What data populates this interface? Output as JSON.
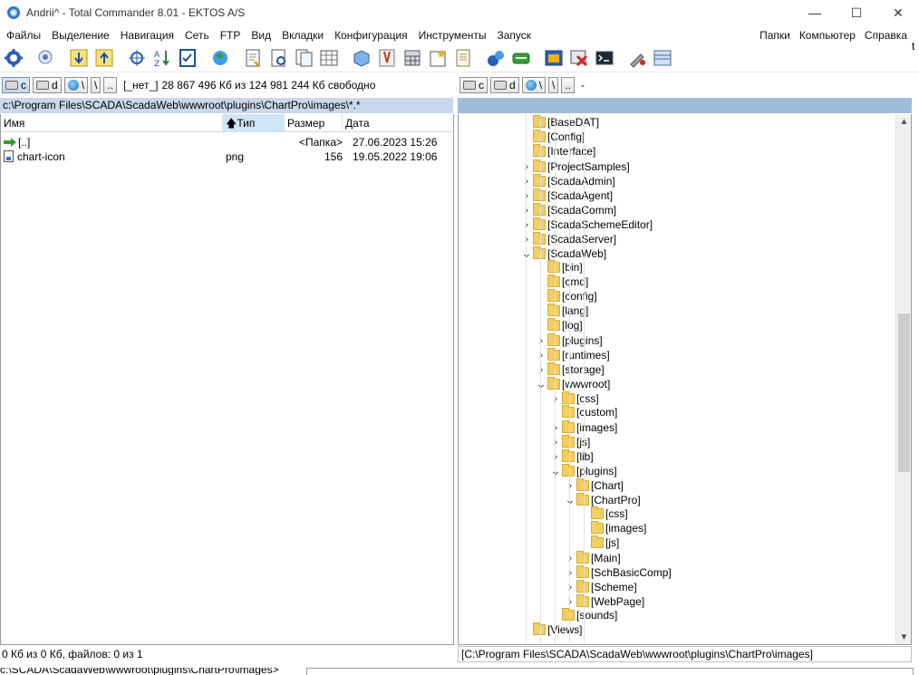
{
  "window": {
    "title": "Andrii^ - Total Commander 8.01 - EKTOS A/S",
    "controls": [
      "—",
      "☐",
      "✕"
    ]
  },
  "menu": {
    "left": [
      "Файлы",
      "Выделение",
      "Навигация",
      "Сеть",
      "FTP",
      "Вид",
      "Вкладки",
      "Конфигурация",
      "Инструменты",
      "Запуск"
    ],
    "right": [
      "Папки",
      "Компьютер",
      "Справка"
    ]
  },
  "toolbar": {
    "buttons": [
      "gear-icon",
      "network-settings-icon",
      "sort-down-icon",
      "sort-up-icon",
      "compare-icon",
      "sort-az-icon",
      "checklist-icon",
      "world-icon",
      "view-file-icon",
      "edit-file-icon",
      "copy-file-icon",
      "grid-view-icon",
      "box-icon",
      "rename-tool-icon",
      "calculator-icon",
      "star-icon",
      "notepad-icon",
      "pack-icon",
      "unpack-icon",
      "window-icon",
      "delete-icon",
      "terminal-icon",
      "brush-icon",
      "panel-icon"
    ]
  },
  "left_drivebar": {
    "drives": [
      "c",
      "d"
    ],
    "root": "\\",
    "up": "..",
    "volume": "[_нет_]",
    "free": "28 867 496 Кб из 124 981 244 Кб свободно"
  },
  "right_drivebar": {
    "drives": [
      "c",
      "d"
    ],
    "root": "\\",
    "up": "..",
    "free": "-"
  },
  "left_panel": {
    "path": "c:\\Program Files\\SCADA\\ScadaWeb\\wwwroot\\plugins\\ChartPro\\images\\*.*",
    "columns": [
      "Имя",
      "Тип",
      "Размер",
      "Дата"
    ],
    "sorted_column": "Тип",
    "rows": [
      {
        "name": "[..]",
        "type": "",
        "size": "<Папка>",
        "date": "27.06.2023 15:26"
      },
      {
        "name": "chart-icon",
        "type": "png",
        "size": "156",
        "date": "19.05.2022 19:06"
      }
    ]
  },
  "tree": [
    {
      "label": "[BaseDAT]",
      "level": 0,
      "chev": ""
    },
    {
      "label": "[Config]",
      "level": 0,
      "chev": ""
    },
    {
      "label": "[Interface]",
      "level": 0,
      "chev": ""
    },
    {
      "label": "[ProjectSamples]",
      "level": 0,
      "chev": ">"
    },
    {
      "label": "[ScadaAdmin]",
      "level": 0,
      "chev": ">"
    },
    {
      "label": "[ScadaAgent]",
      "level": 0,
      "chev": ">"
    },
    {
      "label": "[ScadaComm]",
      "level": 0,
      "chev": ">"
    },
    {
      "label": "[ScadaSchemeEditor]",
      "level": 0,
      "chev": ">"
    },
    {
      "label": "[ScadaServer]",
      "level": 0,
      "chev": ">"
    },
    {
      "label": "[ScadaWeb]",
      "level": 0,
      "chev": "v"
    },
    {
      "label": "[bin]",
      "level": 1,
      "chev": ""
    },
    {
      "label": "[cmd]",
      "level": 1,
      "chev": ""
    },
    {
      "label": "[config]",
      "level": 1,
      "chev": ""
    },
    {
      "label": "[lang]",
      "level": 1,
      "chev": ""
    },
    {
      "label": "[log]",
      "level": 1,
      "chev": ""
    },
    {
      "label": "[plugins]",
      "level": 1,
      "chev": ">"
    },
    {
      "label": "[runtimes]",
      "level": 1,
      "chev": ">"
    },
    {
      "label": "[storage]",
      "level": 1,
      "chev": ">"
    },
    {
      "label": "[wwwroot]",
      "level": 1,
      "chev": "v"
    },
    {
      "label": "[css]",
      "level": 2,
      "chev": ">"
    },
    {
      "label": "[custom]",
      "level": 2,
      "chev": ""
    },
    {
      "label": "[images]",
      "level": 2,
      "chev": ">"
    },
    {
      "label": "[js]",
      "level": 2,
      "chev": ">"
    },
    {
      "label": "[lib]",
      "level": 2,
      "chev": ">"
    },
    {
      "label": "[plugins]",
      "level": 2,
      "chev": "v"
    },
    {
      "label": "[Chart]",
      "level": 3,
      "chev": ">"
    },
    {
      "label": "[ChartPro]",
      "level": 3,
      "chev": "v"
    },
    {
      "label": "[css]",
      "level": 4,
      "chev": ""
    },
    {
      "label": "[images]",
      "level": 4,
      "chev": ""
    },
    {
      "label": "[js]",
      "level": 4,
      "chev": ""
    },
    {
      "label": "[Main]",
      "level": 3,
      "chev": ">"
    },
    {
      "label": "[SchBasicComp]",
      "level": 3,
      "chev": ">"
    },
    {
      "label": "[Scheme]",
      "level": 3,
      "chev": ">"
    },
    {
      "label": "[WebPage]",
      "level": 3,
      "chev": ">"
    },
    {
      "label": "[sounds]",
      "level": 2,
      "chev": ""
    },
    {
      "label": "[Views]",
      "level": 0,
      "chev": ""
    }
  ],
  "status": {
    "left": "0 Кб из 0 Кб, файлов: 0 из 1",
    "right": "[C:\\Program Files\\SCADA\\ScadaWeb\\wwwroot\\plugins\\ChartPro\\images]",
    "cmd_prompt": "c:\\SCADA\\ScadaWeb\\wwwroot\\plugins\\ChartPro\\images>"
  },
  "edge_char": "t",
  "colors": {
    "left_path_bg": "#c9d8ea",
    "right_path_bg": "#9fbcdd",
    "folder": "#f3cf62",
    "sorted_column": "#cfe4f7"
  }
}
